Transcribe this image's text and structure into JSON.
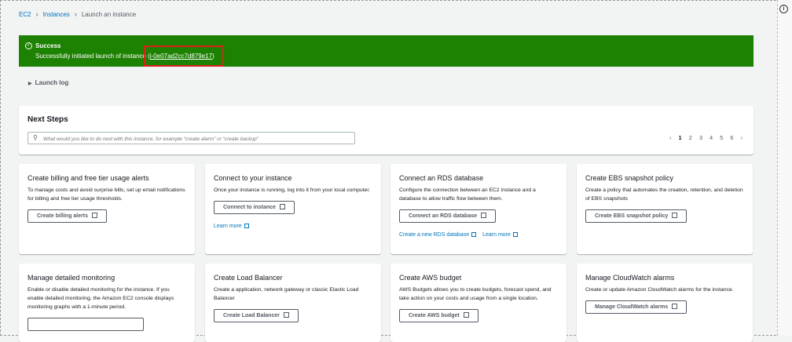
{
  "breadcrumb": {
    "ec2": "EC2",
    "instances": "Instances",
    "current": "Launch an instance"
  },
  "success": {
    "title": "Success",
    "message_prefix": "Successfully initiated launch of instance (",
    "instance_id": "i-0e07ad2cc7d879e17",
    "message_suffix": ")"
  },
  "launch_log": "Launch log",
  "next_steps": {
    "title": "Next Steps",
    "search_placeholder": "What would you like to do next with this instance, for example “create alarm” or “create backup”",
    "pages": [
      "1",
      "2",
      "3",
      "4",
      "5",
      "6"
    ]
  },
  "cards": [
    {
      "title": "Create billing and free tier usage alerts",
      "desc": "To manage costs and avoid surprise bills, set up email notifications for billing and free tier usage thresholds.",
      "button": "Create billing alerts"
    },
    {
      "title": "Connect to your instance",
      "desc": "Once your instance is running, log into it from your local computer.",
      "button": "Connect to instance",
      "link1": "Learn more"
    },
    {
      "title": "Connect an RDS database",
      "desc": "Configure the connection between an EC2 instance and a database to allow traffic flow between them.",
      "button": "Connect an RDS database",
      "link1": "Create a new RDS database",
      "link2": "Learn more"
    },
    {
      "title": "Create EBS snapshot policy",
      "desc": "Create a policy that automates the creation, retention, and deletion of EBS snapshots",
      "button": "Create EBS snapshot policy"
    },
    {
      "title": "Manage detailed monitoring",
      "desc": "Enable or disable detailed monitoring for the instance. If you enable detailed monitoring, the Amazon EC2 console displays monitoring graphs with a 1-minute period."
    },
    {
      "title": "Create Load Balancer",
      "desc": "Create a application, network gateway or classic Elastic Load Balancer",
      "button": "Create Load Balancer"
    },
    {
      "title": "Create AWS budget",
      "desc": "AWS Budgets allows you to create budgets, forecast spend, and take action on your costs and usage from a single location.",
      "button": "Create AWS budget"
    },
    {
      "title": "Manage CloudWatch alarms",
      "desc": "Create or update Amazon CloudWatch alarms for the instance.",
      "button": "Manage CloudWatch alarms"
    }
  ]
}
